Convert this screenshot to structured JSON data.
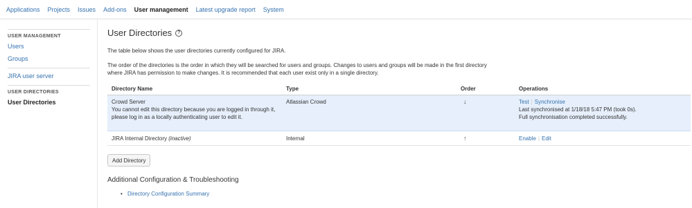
{
  "topnav": {
    "items": [
      {
        "label": "Applications",
        "active": false
      },
      {
        "label": "Projects",
        "active": false
      },
      {
        "label": "Issues",
        "active": false
      },
      {
        "label": "Add-ons",
        "active": false
      },
      {
        "label": "User management",
        "active": true
      },
      {
        "label": "Latest upgrade report",
        "active": false
      },
      {
        "label": "System",
        "active": false
      }
    ]
  },
  "sidebar": {
    "section1_title": "USER MANAGEMENT",
    "users": "Users",
    "groups": "Groups",
    "jira_user_server": "JIRA user server",
    "section2_title": "USER DIRECTORIES",
    "user_directories": "User Directories"
  },
  "main": {
    "title": "User Directories",
    "help_icon": "?",
    "desc1": "The table below shows the user directories currently configured for JIRA.",
    "desc2": "The order of the directories is the order in which they will be searched for users and groups. Changes to users and groups will be made in the first directory where JIRA has permission to make changes. It is recommended that each user exist only in a single directory.",
    "table": {
      "headers": {
        "name": "Directory Name",
        "type": "Type",
        "order": "Order",
        "operations": "Operations"
      },
      "rows": [
        {
          "name": "Crowd Server",
          "note": "You cannot edit this directory because you are logged in through it, please log in as a locally authenticating user to edit it.",
          "type": "Atlassian Crowd",
          "order_arrow": "↓",
          "op1": "Test",
          "op2": "Synchronise",
          "sync_line1": "Last synchronised at 1/18/18 5:47 PM (took 0s).",
          "sync_line2": "Full synchronisation completed successfully."
        },
        {
          "name": "JIRA Internal Directory",
          "status": "(inactive)",
          "type": "Internal",
          "order_arrow": "↑",
          "op1": "Enable",
          "op2": "Edit"
        }
      ]
    },
    "add_button": "Add Directory",
    "subhead": "Additional Configuration & Troubleshooting",
    "links": [
      "Directory Configuration Summary"
    ]
  }
}
